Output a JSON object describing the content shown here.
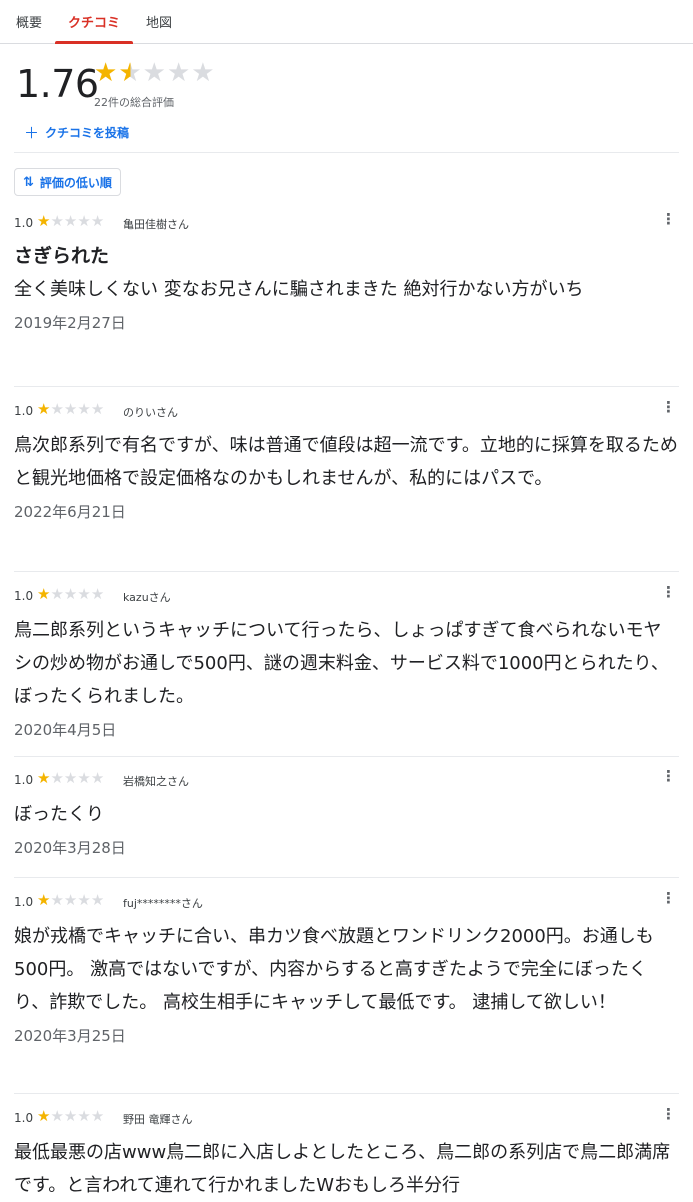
{
  "tabs": [
    {
      "label": "概要"
    },
    {
      "label": "クチコミ"
    },
    {
      "label": "地図"
    }
  ],
  "summary": {
    "rating": "1.76",
    "stars_filled": 1.5,
    "total_text": "22件の総合評価",
    "post_label": "クチコミを投稿"
  },
  "sort": {
    "label": "評価の低い順"
  },
  "reviews": [
    {
      "score": "1.0",
      "author": "亀田佳樹さん",
      "title": "さぎられた",
      "body": "全く美味しくない 変なお兄さんに騙されまきた 絶対行かない方がいち",
      "date": "2019年2月27日"
    },
    {
      "score": "1.0",
      "author": "のりいさん",
      "title": "",
      "body": "鳥次郎系列で有名ですが、味は普通で値段は超一流です。立地的に採算を取るためと観光地価格で設定価格なのかもしれませんが、私的にはパスで。",
      "date": "2022年6月21日"
    },
    {
      "score": "1.0",
      "author": "kazuさん",
      "title": "",
      "body": "鳥二郎系列というキャッチについて行ったら、しょっぱすぎて食べられないモヤシの炒め物がお通しで500円、謎の週末料金、サービス料で1000円とられたり、ぼったくられました。",
      "date": "2020年4月5日"
    },
    {
      "score": "1.0",
      "author": "岩橋知之さん",
      "title": "",
      "body": "ぼったくり",
      "date": "2020年3月28日"
    },
    {
      "score": "1.0",
      "author": "fuj********さん",
      "title": "",
      "body": "娘が戎橋でキャッチに合い、串カツ食べ放題とワンドリンク2000円。お通しも500円。 激高ではないですが、内容からすると高すぎたようで完全にぼったくり、詐欺でした。 高校生相手にキャッチして最低です。 逮捕して欲しい！",
      "date": "2020年3月25日"
    },
    {
      "score": "1.0",
      "author": "野田 竜輝さん",
      "title": "",
      "body": "最低最悪の店www鳥二郎に入店しよとしたところ、鳥二郎の系列店で鳥二郎満席です。と言われて連れて行かれましたWおもしろ半分行",
      "date": ""
    }
  ],
  "review_stars_filled": 1,
  "colors": {
    "accent": "#d93025",
    "link": "#1a73e8",
    "star": "#f4b400",
    "star_empty": "#dadce0"
  }
}
